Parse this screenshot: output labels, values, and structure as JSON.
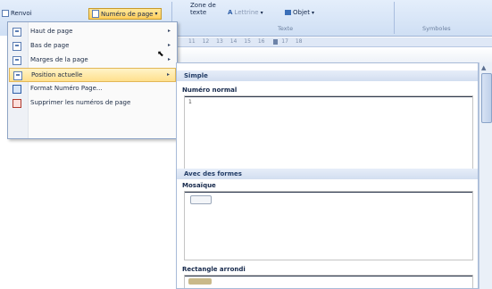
{
  "ribbon": {
    "renvoi_label": "Renvoi",
    "page_number_label": "Numéro de page",
    "text_zone_line1": "Zone de",
    "text_zone_line2": "texte",
    "lettrine_label": "Lettrine",
    "objet_label": "Objet",
    "group_texte": "Texte",
    "group_symboles": "Symboles"
  },
  "ruler": {
    "marks": [
      "11",
      "12",
      "13",
      "14",
      "15",
      "16",
      "17",
      "18"
    ]
  },
  "menu": {
    "items": [
      {
        "label": "Haut de page",
        "has_submenu": true
      },
      {
        "label": "Bas de page",
        "has_submenu": true
      },
      {
        "label": "Marges de la page",
        "has_submenu": true
      },
      {
        "label": "Position actuelle",
        "has_submenu": true
      },
      {
        "label": "Format Numéro Page...",
        "has_submenu": false
      },
      {
        "label": "Supprimer les numéros de page",
        "has_submenu": false
      }
    ],
    "submenu_arrow": "▸",
    "highlighted_index": 3
  },
  "gallery": {
    "section1": "Simple",
    "item1": "Numéro normal",
    "item1_value": "1",
    "section2": "Avec des formes",
    "item2": "Mosaïque",
    "item3": "Rectangle arrondi"
  },
  "colors": {
    "ribbon_bg": "#cfdff4",
    "menu_highlight": "#ffe08d",
    "section_header": "#d2def0"
  }
}
